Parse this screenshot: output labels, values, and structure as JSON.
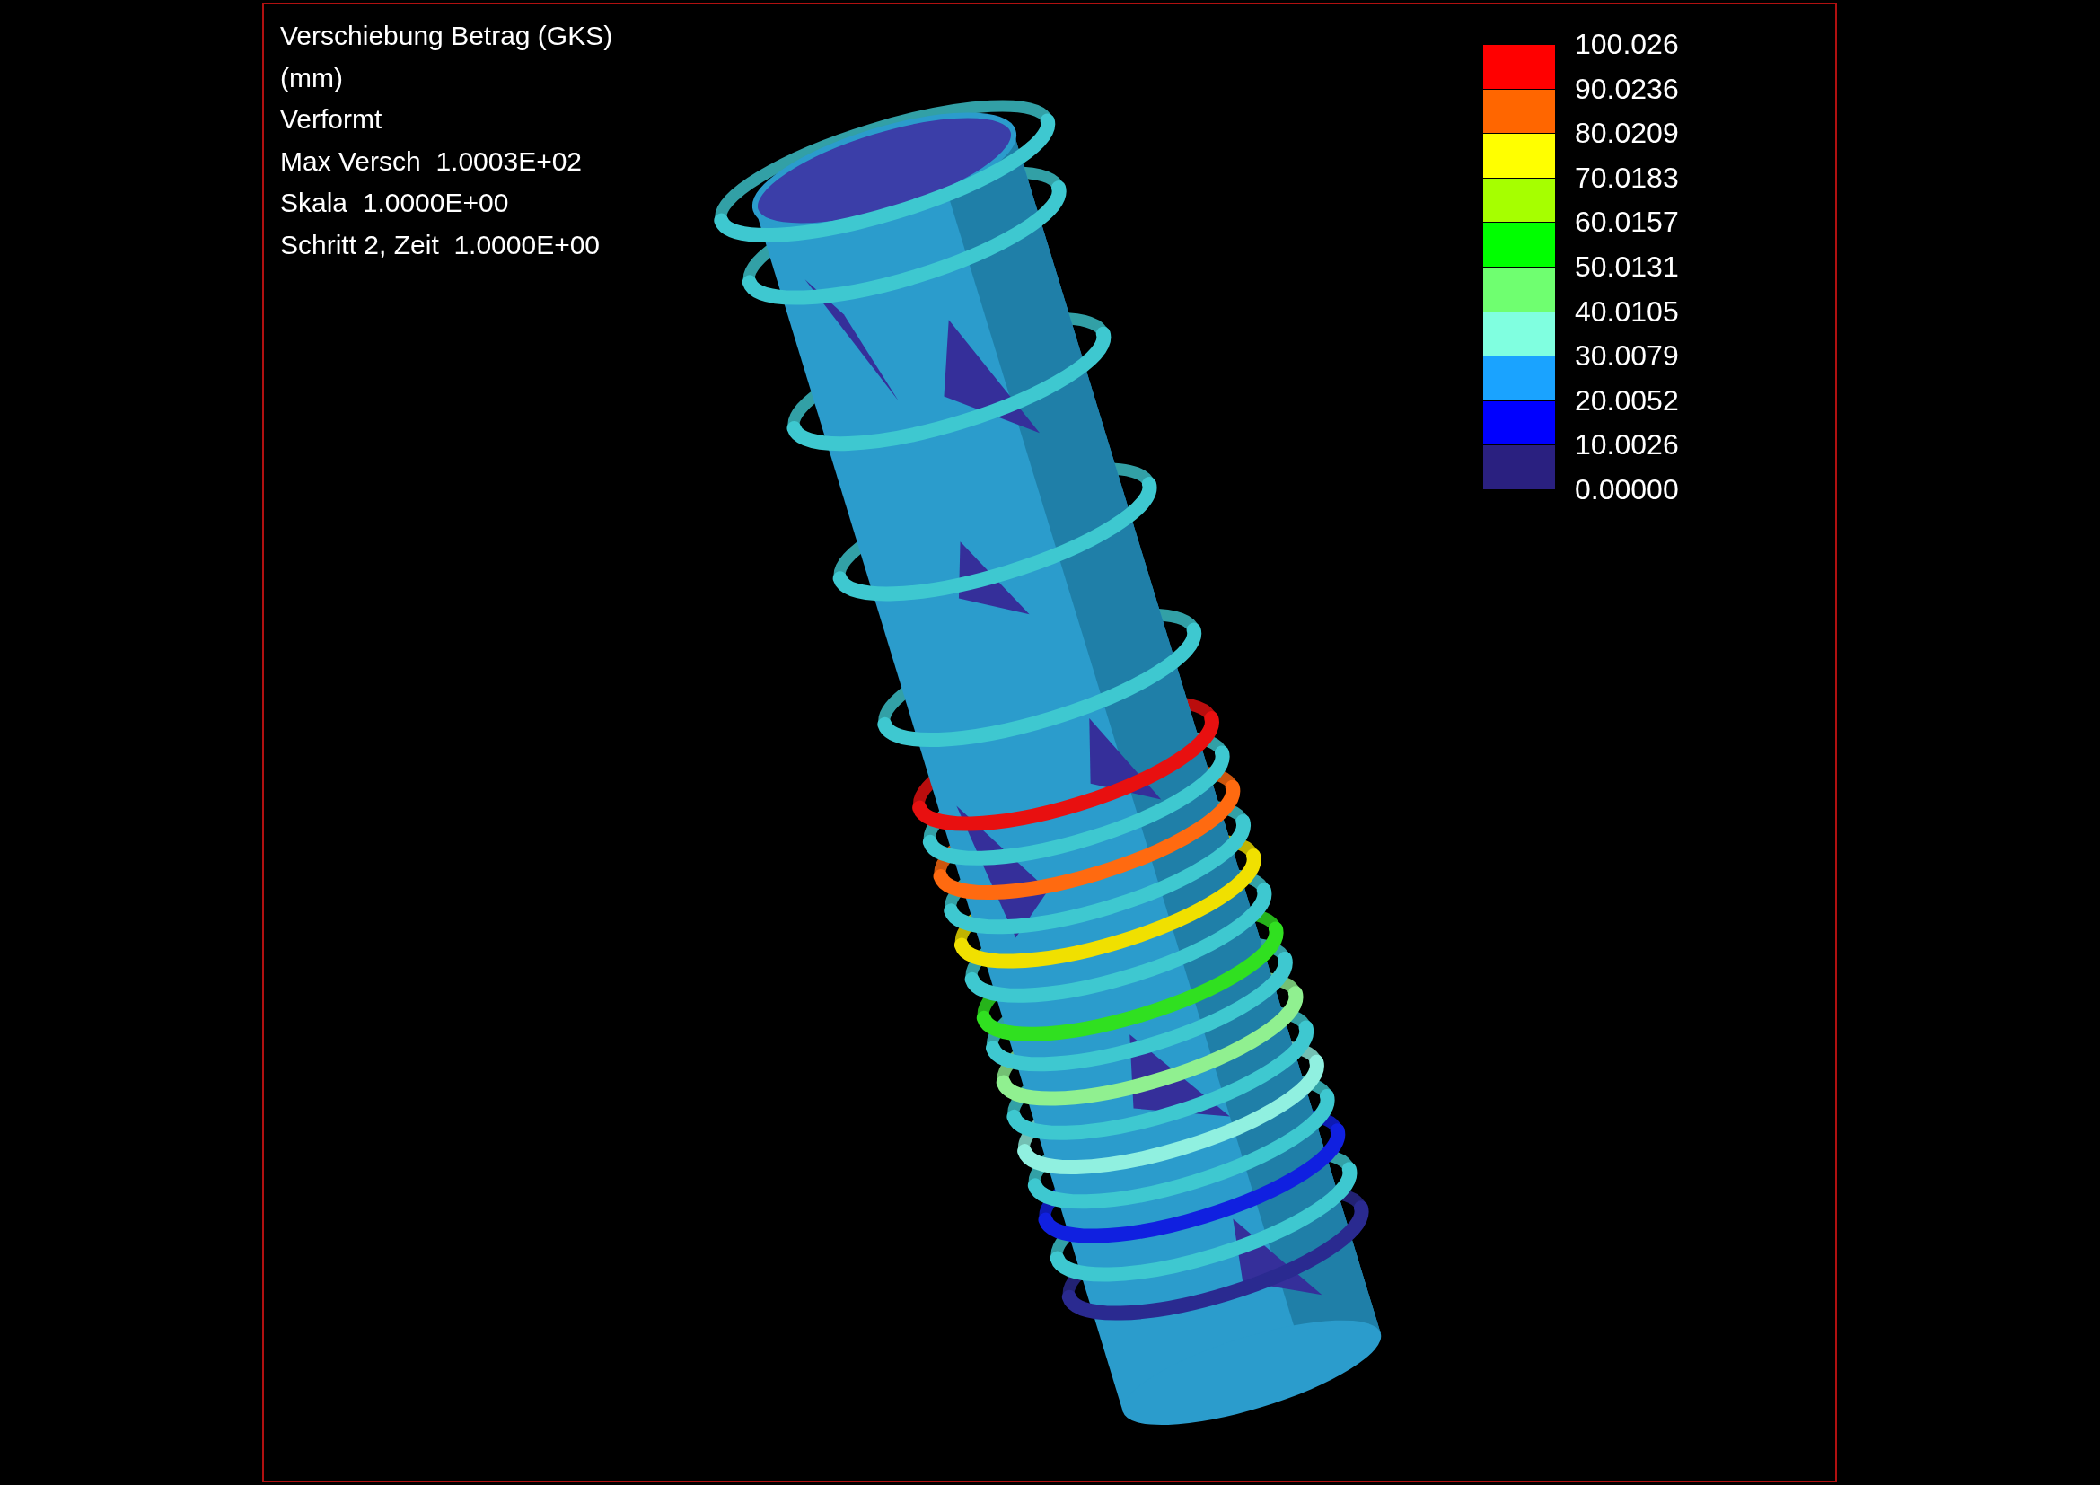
{
  "info_lines": [
    "Verschiebung Betrag (GKS)",
    "(mm)",
    "Verformt",
    "Max Versch  1.0003E+02",
    "Skala  1.0000E+00",
    "Schritt 2, Zeit  1.0000E+00"
  ],
  "legend": {
    "labels": [
      "100.026",
      "90.0236",
      "80.0209",
      "70.0183",
      "60.0157",
      "50.0131",
      "40.0105",
      "30.0079",
      "20.0052",
      "10.0026",
      "0.00000"
    ],
    "bands": [
      {
        "color": "#ff0000"
      },
      {
        "color": "#ff6600"
      },
      {
        "color": "#ffff00"
      },
      {
        "color": "#a6ff00"
      },
      {
        "color": "#00ff00"
      },
      {
        "color": "#6fff70"
      },
      {
        "color": "#80ffe0"
      },
      {
        "color": "#1aa3ff"
      },
      {
        "color": "#0000ff"
      },
      {
        "color": "#2a2080"
      }
    ]
  }
}
